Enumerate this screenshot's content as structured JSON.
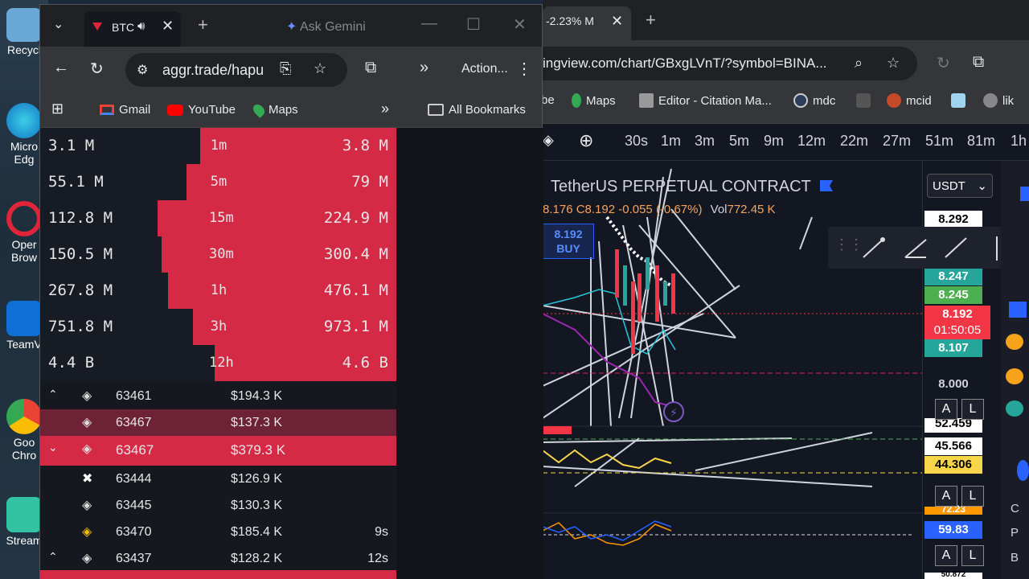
{
  "desktop": {
    "icons": [
      {
        "label": "Recycl"
      },
      {
        "label": "Micro Edg"
      },
      {
        "label": "Oper Brow"
      },
      {
        "label": "TeamV"
      },
      {
        "label": "Goo Chro"
      },
      {
        "label": "Stream"
      }
    ]
  },
  "tv_browser": {
    "tab_title": "-2.23% M",
    "url": "ingview.com/chart/GBxgLVnT/?symbol=BINA...",
    "bookmarks": [
      "be",
      "Maps",
      "Editor - Citation Ma...",
      "mdc",
      "mcid",
      "lik"
    ],
    "intervals": [
      "30s",
      "1m",
      "3m",
      "5m",
      "9m",
      "12m",
      "22m",
      "27m",
      "51m",
      "81m",
      "1h"
    ],
    "symbol_title": "TetherUS PERPETUAL CONTRACT",
    "ohlc": "8.176 C8.192 -0.055 (-0.67%)",
    "vol_label": "Vol",
    "vol_value": "772.45 K",
    "currency": "USDT",
    "buy_price": "8.192",
    "buy_label": "BUY",
    "price_tags": {
      "p1": "8.292",
      "p2": "8.247",
      "p3": "8.245",
      "p4": "8.192",
      "countdown": "01:50:05",
      "p5": "8.107",
      "p6": "8.000",
      "p7": "52.459",
      "p8": "45.566",
      "p9": "44.306",
      "p10": "59.83",
      "p11": "72.23",
      "p12": "50.872"
    },
    "al_a": "A",
    "al_l": "L",
    "rightcol_letters": [
      "C",
      "P",
      "B"
    ],
    "colors": {
      "red": "#f23645",
      "green": "#26a69a",
      "blue": "#2962ff",
      "yellow": "#f7d64a"
    }
  },
  "aggr_browser": {
    "tab_title": "BTC",
    "gemini": "Ask Gemini",
    "url": "aggr.trade/hapu",
    "actions": "Action...",
    "bookmarks": {
      "gmail": "Gmail",
      "youtube": "YouTube",
      "maps": "Maps",
      "all": "All Bookmarks"
    },
    "stats": [
      {
        "left": "3.1 M",
        "tf": "1m",
        "right": "3.8 M",
        "fill": 0.55
      },
      {
        "left": "55.1 M",
        "tf": "5m",
        "right": "79 M",
        "fill": 0.59
      },
      {
        "left": "112.8 M",
        "tf": "15m",
        "right": "224.9 M",
        "fill": 0.67
      },
      {
        "left": "150.5 M",
        "tf": "30m",
        "right": "300.4 M",
        "fill": 0.66
      },
      {
        "left": "267.8 M",
        "tf": "1h",
        "right": "476.1 M",
        "fill": 0.64
      },
      {
        "left": "751.8 M",
        "tf": "3h",
        "right": "973.1 M",
        "fill": 0.57
      },
      {
        "left": "4.4 B",
        "tf": "12h",
        "right": "4.6 B",
        "fill": 0.51
      }
    ],
    "trades": [
      {
        "arrow": "^",
        "exchange": "okx",
        "price": "63461",
        "amount": "$194.3 K",
        "age": "",
        "style": "none"
      },
      {
        "arrow": "",
        "exchange": "okx",
        "price": "63467",
        "amount": "$137.3 K",
        "age": "",
        "style": "dark"
      },
      {
        "arrow": "v",
        "exchange": "okx",
        "price": "63467",
        "amount": "$379.3 K",
        "age": "",
        "style": "bright"
      },
      {
        "arrow": "",
        "exchange": "bitmex",
        "price": "63444",
        "amount": "$126.9 K",
        "age": "",
        "style": "none"
      },
      {
        "arrow": "",
        "exchange": "okx",
        "price": "63445",
        "amount": "$130.3 K",
        "age": "",
        "style": "none"
      },
      {
        "arrow": "",
        "exchange": "binance",
        "price": "63470",
        "amount": "$185.4 K",
        "age": "9s",
        "style": "none"
      },
      {
        "arrow": "^",
        "exchange": "okx",
        "price": "63437",
        "amount": "$128.2 K",
        "age": "12s",
        "style": "none"
      }
    ],
    "colors": {
      "sell": "#d42a46",
      "sell_dark": "#6e2235",
      "bg": "#171b24"
    }
  }
}
